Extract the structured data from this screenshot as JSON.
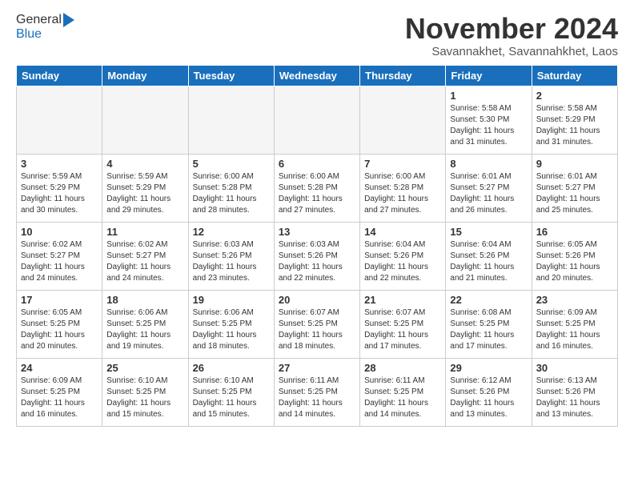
{
  "logo": {
    "general": "General",
    "blue": "Blue"
  },
  "header": {
    "month": "November 2024",
    "location": "Savannakhet, Savannahkhet, Laos"
  },
  "weekdays": [
    "Sunday",
    "Monday",
    "Tuesday",
    "Wednesday",
    "Thursday",
    "Friday",
    "Saturday"
  ],
  "weeks": [
    [
      {
        "day": "",
        "empty": true
      },
      {
        "day": "",
        "empty": true
      },
      {
        "day": "",
        "empty": true
      },
      {
        "day": "",
        "empty": true
      },
      {
        "day": "",
        "empty": true
      },
      {
        "day": "1",
        "info": "Sunrise: 5:58 AM\nSunset: 5:30 PM\nDaylight: 11 hours\nand 31 minutes."
      },
      {
        "day": "2",
        "info": "Sunrise: 5:58 AM\nSunset: 5:29 PM\nDaylight: 11 hours\nand 31 minutes."
      }
    ],
    [
      {
        "day": "3",
        "info": "Sunrise: 5:59 AM\nSunset: 5:29 PM\nDaylight: 11 hours\nand 30 minutes."
      },
      {
        "day": "4",
        "info": "Sunrise: 5:59 AM\nSunset: 5:29 PM\nDaylight: 11 hours\nand 29 minutes."
      },
      {
        "day": "5",
        "info": "Sunrise: 6:00 AM\nSunset: 5:28 PM\nDaylight: 11 hours\nand 28 minutes."
      },
      {
        "day": "6",
        "info": "Sunrise: 6:00 AM\nSunset: 5:28 PM\nDaylight: 11 hours\nand 27 minutes."
      },
      {
        "day": "7",
        "info": "Sunrise: 6:00 AM\nSunset: 5:28 PM\nDaylight: 11 hours\nand 27 minutes."
      },
      {
        "day": "8",
        "info": "Sunrise: 6:01 AM\nSunset: 5:27 PM\nDaylight: 11 hours\nand 26 minutes."
      },
      {
        "day": "9",
        "info": "Sunrise: 6:01 AM\nSunset: 5:27 PM\nDaylight: 11 hours\nand 25 minutes."
      }
    ],
    [
      {
        "day": "10",
        "info": "Sunrise: 6:02 AM\nSunset: 5:27 PM\nDaylight: 11 hours\nand 24 minutes."
      },
      {
        "day": "11",
        "info": "Sunrise: 6:02 AM\nSunset: 5:27 PM\nDaylight: 11 hours\nand 24 minutes."
      },
      {
        "day": "12",
        "info": "Sunrise: 6:03 AM\nSunset: 5:26 PM\nDaylight: 11 hours\nand 23 minutes."
      },
      {
        "day": "13",
        "info": "Sunrise: 6:03 AM\nSunset: 5:26 PM\nDaylight: 11 hours\nand 22 minutes."
      },
      {
        "day": "14",
        "info": "Sunrise: 6:04 AM\nSunset: 5:26 PM\nDaylight: 11 hours\nand 22 minutes."
      },
      {
        "day": "15",
        "info": "Sunrise: 6:04 AM\nSunset: 5:26 PM\nDaylight: 11 hours\nand 21 minutes."
      },
      {
        "day": "16",
        "info": "Sunrise: 6:05 AM\nSunset: 5:26 PM\nDaylight: 11 hours\nand 20 minutes."
      }
    ],
    [
      {
        "day": "17",
        "info": "Sunrise: 6:05 AM\nSunset: 5:25 PM\nDaylight: 11 hours\nand 20 minutes."
      },
      {
        "day": "18",
        "info": "Sunrise: 6:06 AM\nSunset: 5:25 PM\nDaylight: 11 hours\nand 19 minutes."
      },
      {
        "day": "19",
        "info": "Sunrise: 6:06 AM\nSunset: 5:25 PM\nDaylight: 11 hours\nand 18 minutes."
      },
      {
        "day": "20",
        "info": "Sunrise: 6:07 AM\nSunset: 5:25 PM\nDaylight: 11 hours\nand 18 minutes."
      },
      {
        "day": "21",
        "info": "Sunrise: 6:07 AM\nSunset: 5:25 PM\nDaylight: 11 hours\nand 17 minutes."
      },
      {
        "day": "22",
        "info": "Sunrise: 6:08 AM\nSunset: 5:25 PM\nDaylight: 11 hours\nand 17 minutes."
      },
      {
        "day": "23",
        "info": "Sunrise: 6:09 AM\nSunset: 5:25 PM\nDaylight: 11 hours\nand 16 minutes."
      }
    ],
    [
      {
        "day": "24",
        "info": "Sunrise: 6:09 AM\nSunset: 5:25 PM\nDaylight: 11 hours\nand 16 minutes."
      },
      {
        "day": "25",
        "info": "Sunrise: 6:10 AM\nSunset: 5:25 PM\nDaylight: 11 hours\nand 15 minutes."
      },
      {
        "day": "26",
        "info": "Sunrise: 6:10 AM\nSunset: 5:25 PM\nDaylight: 11 hours\nand 15 minutes."
      },
      {
        "day": "27",
        "info": "Sunrise: 6:11 AM\nSunset: 5:25 PM\nDaylight: 11 hours\nand 14 minutes."
      },
      {
        "day": "28",
        "info": "Sunrise: 6:11 AM\nSunset: 5:25 PM\nDaylight: 11 hours\nand 14 minutes."
      },
      {
        "day": "29",
        "info": "Sunrise: 6:12 AM\nSunset: 5:26 PM\nDaylight: 11 hours\nand 13 minutes."
      },
      {
        "day": "30",
        "info": "Sunrise: 6:13 AM\nSunset: 5:26 PM\nDaylight: 11 hours\nand 13 minutes."
      }
    ]
  ]
}
